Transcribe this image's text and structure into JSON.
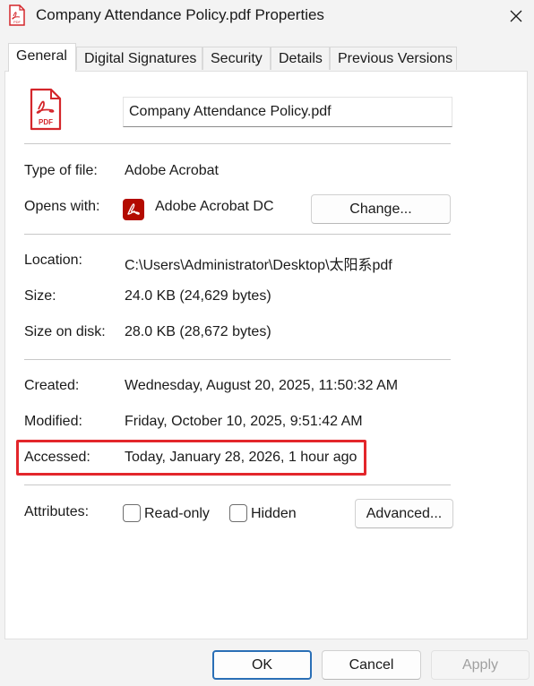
{
  "window": {
    "title": "Company Attendance Policy.pdf Properties"
  },
  "tabs": [
    {
      "label": "General",
      "active": true
    },
    {
      "label": "Digital Signatures"
    },
    {
      "label": "Security"
    },
    {
      "label": "Details"
    },
    {
      "label": "Previous Versions"
    }
  ],
  "general": {
    "file_icon_text": "PDF",
    "file_name": "Company Attendance Policy.pdf",
    "type_label": "Type of file:",
    "type_value": "Adobe Acrobat",
    "opens_label": "Opens with:",
    "opens_value": "Adobe Acrobat DC",
    "change_button": "Change...",
    "location_label": "Location:",
    "location_value": "C:\\Users\\Administrator\\Desktop\\太阳系pdf",
    "size_label": "Size:",
    "size_value": "24.0 KB (24,629 bytes)",
    "size_on_disk_label": "Size on disk:",
    "size_on_disk_value": "28.0 KB (28,672 bytes)",
    "created_label": "Created:",
    "created_value": "Wednesday, August 20, 2025, 11:50:32 AM",
    "modified_label": "Modified:",
    "modified_value": "Friday, October 10, 2025, 9:51:42 AM",
    "accessed_label": "Accessed:",
    "accessed_value": "Today, January 28, 2026, 1 hour ago",
    "attributes_label": "Attributes:",
    "readonly_label": "Read-only",
    "readonly_checked": false,
    "hidden_label": "Hidden",
    "hidden_checked": false,
    "advanced_button": "Advanced..."
  },
  "footer": {
    "ok": "OK",
    "cancel": "Cancel",
    "apply": "Apply"
  },
  "colors": {
    "pdf_red": "#d4262b",
    "highlight": "#e3262b",
    "ok_border": "#2a6fb6"
  },
  "icons": [
    "pdf-file-icon",
    "acrobat-icon",
    "close-icon",
    "checkbox"
  ]
}
